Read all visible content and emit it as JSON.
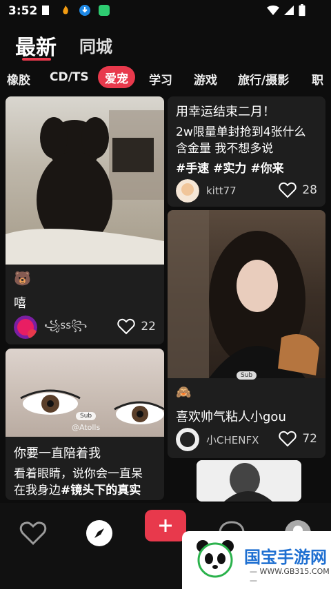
{
  "status_bar": {
    "time": "3:52"
  },
  "header": {
    "tabs": [
      {
        "label": "最新",
        "active": true
      },
      {
        "label": "同城",
        "active": false
      }
    ]
  },
  "categories": [
    {
      "label": "橡胶"
    },
    {
      "label": "CD/TS"
    },
    {
      "label": "爱宠",
      "active": true
    },
    {
      "label": "学习"
    },
    {
      "label": "游戏"
    },
    {
      "label": "旅行/摄影"
    },
    {
      "label": "职"
    }
  ],
  "cards": {
    "dog": {
      "emoji": "🐻",
      "title": "嘻",
      "author": "꧁ss꧂",
      "likes": "22"
    },
    "text_post": {
      "line1": "用幸运结束二月！",
      "line2": "2w限量单封抢到4张什么",
      "line3": "含金量 我不想多说",
      "tags": "#手速  #实力  #你来",
      "author": "kitt77",
      "likes": "28"
    },
    "girl": {
      "badge": "Sub",
      "emoji": "🙈",
      "title": "喜欢帅气粘人小gou",
      "author": "小CHENFX",
      "likes": "72"
    },
    "eye": {
      "badge": "Sub",
      "watermark": "@Atolls",
      "title": "你要一直陪着我",
      "line1": "看着眼睛，说你会一直呆",
      "line2": "在我身边",
      "tag": "#镜头下的真实"
    }
  },
  "bottom_nav": {
    "items": [
      {
        "icon": "heart-icon"
      },
      {
        "icon": "compass-icon"
      },
      {
        "icon": "plus-icon"
      },
      {
        "icon": "chat-bubble-icon"
      },
      {
        "icon": "profile-avatar-icon"
      }
    ]
  },
  "watermark": {
    "main": "国宝手游网",
    "sub": "— WWW.GB315.COM —"
  },
  "colors": {
    "accent": "#e8394c",
    "background": "#0d0d0d",
    "card": "#1e1e1e"
  }
}
